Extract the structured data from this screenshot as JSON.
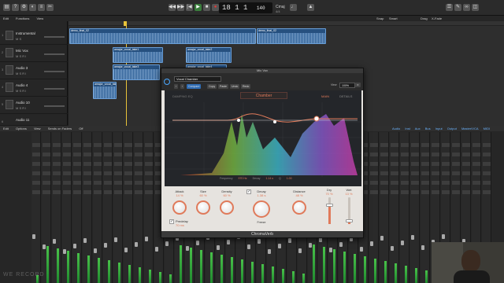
{
  "toolbar": {
    "lcd_time": "18 1 1",
    "lcd_tempo": "140",
    "key": "Cmaj",
    "meter": "4/4",
    "snap_label": "Snap",
    "snap_value": "Smart",
    "drag_label": "Drag",
    "drag_value": "X-Fade"
  },
  "menubar": {
    "edit": "Edit",
    "functions": "Functions",
    "view": "View"
  },
  "tracks": [
    {
      "num": "1",
      "name": "Instrumental",
      "ms": "M S"
    },
    {
      "num": "2",
      "name": "Mic Vox",
      "ms": "M S R I"
    },
    {
      "num": "3",
      "name": "Audio 3",
      "ms": "M S R I"
    },
    {
      "num": "4",
      "name": "Audio 4",
      "ms": "M S R I"
    },
    {
      "num": "5",
      "name": "Audio 10",
      "ms": "M S R I"
    },
    {
      "num": "6",
      "name": "Audio 11",
      "ms": "M S R I"
    }
  ],
  "regions": [
    {
      "name": "demo_final_02"
    },
    {
      "name": "demo_final_02"
    },
    {
      "name": "amajor_vocal_take1"
    },
    {
      "name": "amajor_vocal_take2"
    },
    {
      "name": "amajor_vocal_take3"
    },
    {
      "name": "amajor_vocal_take4"
    },
    {
      "name": "amajor_vocal_take5"
    }
  ],
  "mixer_bar": {
    "edit": "Edit",
    "options": "Options",
    "view": "View",
    "sends": "Sends on Faders",
    "off": "Off"
  },
  "view_tabs": [
    "Audio",
    "Inst",
    "Aux",
    "Bus",
    "Input",
    "Output",
    "Master/VCA",
    "MIDI"
  ],
  "plugin": {
    "window_title": "Mic Vox",
    "preset": "Vocal Chamber",
    "compare": "Compare",
    "copy": "Copy",
    "paste": "Paste",
    "undo": "Undo",
    "redo": "Redo",
    "view_label": "View",
    "view_value": "100%",
    "shaping_label": "DAMPING EQ",
    "room_type": "Chamber",
    "tab_main": "MAIN",
    "tab_details": "DETAILS",
    "readout": {
      "frequency_label": "Frequency",
      "frequency_value": "970 Hz",
      "decay_label": "Decay",
      "decay_value": "1.14 s",
      "q_label": "Q",
      "q_value": "1.00"
    },
    "knobs": [
      {
        "label": "Attack",
        "value": "14 %"
      },
      {
        "label": "Size",
        "value": "60 %"
      },
      {
        "label": "Density",
        "value": "60 %"
      },
      {
        "label": "Decay",
        "value": "1.38 s"
      },
      {
        "label": "Distance",
        "value": "48 %"
      }
    ],
    "freeze": "Freeze",
    "predelay_label": "Predelay",
    "predelay_value": "70 ms",
    "dry_label": "Dry",
    "dry_value": "70 %",
    "dry_level": 0.7,
    "wet_label": "Wet",
    "wet_value": "13 %",
    "wet_level": 0.13,
    "footer": "ChromaVerb"
  },
  "watermark": "WE RECORD",
  "colors": {
    "accent": "#e07a5a",
    "region": "#2d5f96",
    "play": "#4caf50",
    "record": "#e53935"
  }
}
